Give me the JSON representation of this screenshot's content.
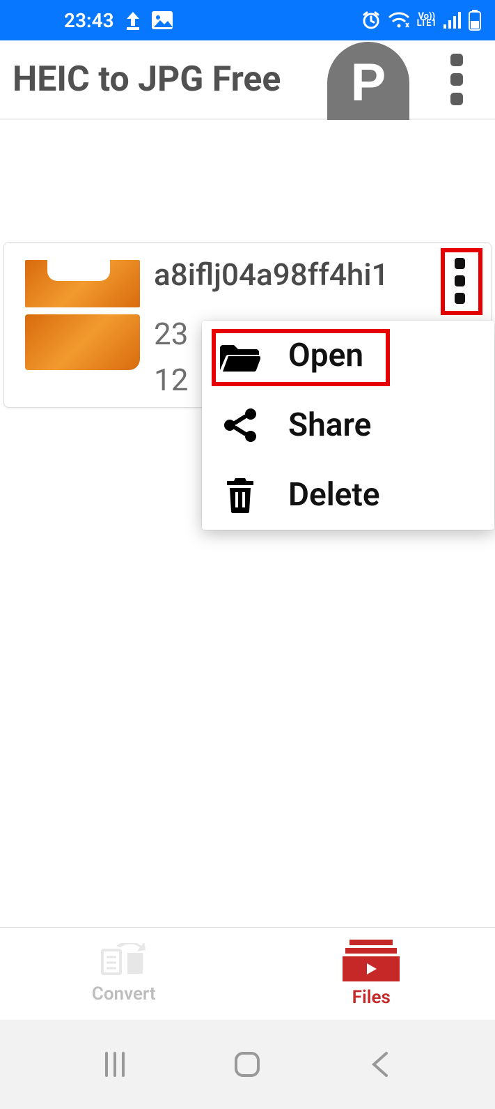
{
  "status": {
    "time": "23:43",
    "lte_label": "LTE1",
    "vo_label": "Vo))"
  },
  "header": {
    "title": "HEIC to JPG Free",
    "p_label": "P"
  },
  "file": {
    "name": "a8iflj04a98ff4hi1",
    "line1": "23",
    "line2": "12"
  },
  "menu": {
    "open": "Open",
    "share": "Share",
    "delete": "Delete"
  },
  "tabs": {
    "convert": "Convert",
    "files": "Files"
  }
}
